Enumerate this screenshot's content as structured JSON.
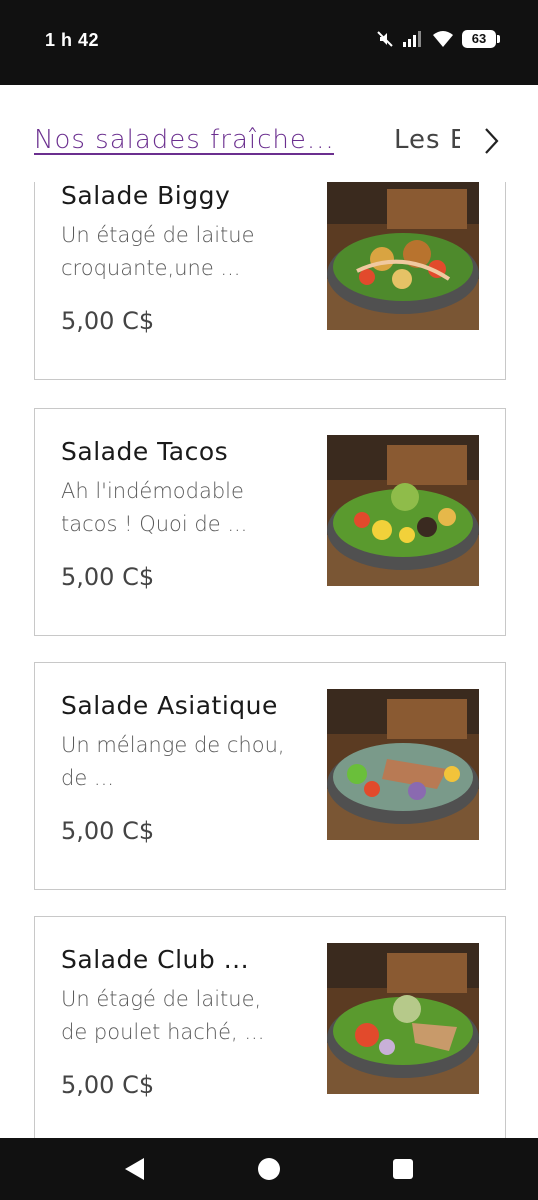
{
  "status_bar": {
    "time": "1 h 42",
    "battery": "63",
    "icons": [
      "mute-icon",
      "signal-icon",
      "wifi-icon",
      "battery-icon"
    ]
  },
  "tabs": {
    "active_label": "Nos salades fraîche...",
    "next_label": "Les E",
    "next_icon": "chevron-right-icon",
    "active_color": "#6b2f8f"
  },
  "items": [
    {
      "title": "Salade Biggy",
      "description": "Un étagé de laitue croquante,une ...",
      "price": "5,00 C$"
    },
    {
      "title": "Salade Tacos",
      "description": "Ah l'indémodable tacos ! Quoi de ...",
      "price": "5,00 C$"
    },
    {
      "title": "Salade Asiatique",
      "description": "Un mélange de chou, de ...",
      "price": "5,00 C$"
    },
    {
      "title": "Salade Club ...",
      "description": "Un étagé de laitue, de poulet haché, ...",
      "price": "5,00 C$"
    }
  ],
  "nav_bar": {
    "buttons": [
      "back-icon",
      "home-icon",
      "recents-icon"
    ]
  }
}
